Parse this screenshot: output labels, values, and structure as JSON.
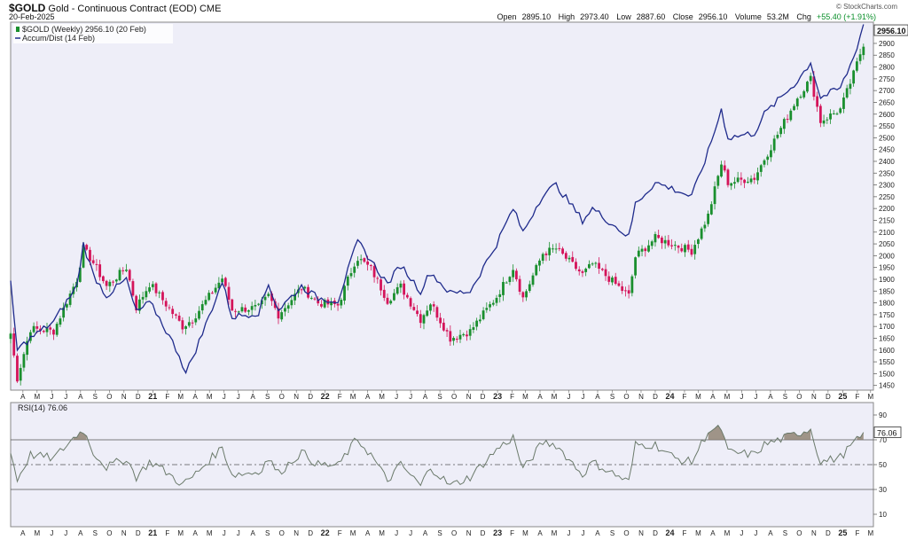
{
  "header": {
    "symbol": "$GOLD",
    "description": "Gold - Continuous Contract (EOD)",
    "exchange": "CME",
    "date": "20-Feb-2025",
    "source": "© StockCharts.com",
    "ohlc": {
      "open_label": "Open",
      "open": "2895.10",
      "high_label": "High",
      "high": "2973.40",
      "low_label": "Low",
      "low": "2887.60",
      "close_label": "Close",
      "close": "2956.10",
      "volume_label": "Volume",
      "volume": "53.2M",
      "chg_label": "Chg",
      "chg": "+55.40 (+1.91%)"
    }
  },
  "colors": {
    "up": "#1a8f2e",
    "down": "#d4145a",
    "accum": "#1f2b8c",
    "rsi": "#6b7a6b",
    "bg": "#eeeef8"
  },
  "chart_data": [
    {
      "type": "candlestick",
      "title": "$GOLD (Weekly)",
      "legend": [
        "$GOLD (Weekly) 2956.10 (20 Feb)",
        "Accum/Dist (14 Feb)"
      ],
      "y_ticks": [
        1450,
        1500,
        1550,
        1600,
        1650,
        1700,
        1750,
        1800,
        1850,
        1900,
        1950,
        2000,
        2050,
        2100,
        2150,
        2200,
        2250,
        2300,
        2350,
        2400,
        2450,
        2500,
        2550,
        2600,
        2650,
        2700,
        2750,
        2800,
        2850,
        2900
      ],
      "ylim": [
        1430,
        2990
      ],
      "last_value_label": "2956.10",
      "x_month_labels": [
        "M",
        "A",
        "M",
        "J",
        "J",
        "A",
        "S",
        "O",
        "N",
        "D",
        "21",
        "F",
        "M",
        "A",
        "M",
        "J",
        "J",
        "A",
        "S",
        "O",
        "N",
        "D",
        "22",
        "F",
        "M",
        "A",
        "M",
        "J",
        "J",
        "A",
        "S",
        "O",
        "N",
        "D",
        "23",
        "F",
        "M",
        "A",
        "M",
        "J",
        "J",
        "A",
        "S",
        "O",
        "N",
        "D",
        "24",
        "F",
        "M",
        "A",
        "M",
        "J",
        "J",
        "A",
        "S",
        "O",
        "N",
        "D",
        "25",
        "F",
        "M"
      ],
      "close_anchors": [
        [
          "2020-03-06",
          1670
        ],
        [
          "2020-03-20",
          1480
        ],
        [
          "2020-04-17",
          1690
        ],
        [
          "2020-06-05",
          1680
        ],
        [
          "2020-07-24",
          1900
        ],
        [
          "2020-08-07",
          2030
        ],
        [
          "2020-08-28",
          1970
        ],
        [
          "2020-09-25",
          1870
        ],
        [
          "2020-11-06",
          1950
        ],
        [
          "2020-11-27",
          1780
        ],
        [
          "2020-12-25",
          1880
        ],
        [
          "2021-01-08",
          1850
        ],
        [
          "2021-03-05",
          1700
        ],
        [
          "2021-03-26",
          1730
        ],
        [
          "2021-05-28",
          1905
        ],
        [
          "2021-06-18",
          1770
        ],
        [
          "2021-08-13",
          1780
        ],
        [
          "2021-09-03",
          1830
        ],
        [
          "2021-09-24",
          1750
        ],
        [
          "2021-11-12",
          1865
        ],
        [
          "2021-12-17",
          1800
        ],
        [
          "2022-01-28",
          1790
        ],
        [
          "2022-03-04",
          1970
        ],
        [
          "2022-03-11",
          1990
        ],
        [
          "2022-04-08",
          1945
        ],
        [
          "2022-05-13",
          1810
        ],
        [
          "2022-06-10",
          1870
        ],
        [
          "2022-07-22",
          1730
        ],
        [
          "2022-08-12",
          1800
        ],
        [
          "2022-09-23",
          1650
        ],
        [
          "2022-11-04",
          1680
        ],
        [
          "2022-12-30",
          1826
        ],
        [
          "2023-02-03",
          1950
        ],
        [
          "2023-02-24",
          1820
        ],
        [
          "2023-04-07",
          2010
        ],
        [
          "2023-05-05",
          2030
        ],
        [
          "2023-06-30",
          1920
        ],
        [
          "2023-07-21",
          1965
        ],
        [
          "2023-10-06",
          1830
        ],
        [
          "2023-10-20",
          1995
        ],
        [
          "2023-12-01",
          2075
        ],
        [
          "2024-01-12",
          2045
        ],
        [
          "2024-02-16",
          2020
        ],
        [
          "2024-03-22",
          2170
        ],
        [
          "2024-04-19",
          2390
        ],
        [
          "2024-05-03",
          2310
        ],
        [
          "2024-06-28",
          2330
        ],
        [
          "2024-07-19",
          2410
        ],
        [
          "2024-09-27",
          2670
        ],
        [
          "2024-10-25",
          2750
        ],
        [
          "2024-11-15",
          2570
        ],
        [
          "2024-12-27",
          2620
        ],
        [
          "2025-01-24",
          2770
        ],
        [
          "2025-02-14",
          2900
        ],
        [
          "2025-02-20",
          2956
        ]
      ]
    },
    {
      "type": "line",
      "title": "Accum/Dist (14 Feb)",
      "anchors_price_units": [
        [
          "2020-03-06",
          1880
        ],
        [
          "2020-03-20",
          1600
        ],
        [
          "2020-04-17",
          1650
        ],
        [
          "2020-06-05",
          1720
        ],
        [
          "2020-07-24",
          1870
        ],
        [
          "2020-08-07",
          2050
        ],
        [
          "2020-08-28",
          1920
        ],
        [
          "2020-09-25",
          1830
        ],
        [
          "2020-11-06",
          1900
        ],
        [
          "2020-11-27",
          1760
        ],
        [
          "2020-12-25",
          1800
        ],
        [
          "2021-01-08",
          1760
        ],
        [
          "2021-02-26",
          1580
        ],
        [
          "2021-03-12",
          1500
        ],
        [
          "2021-04-16",
          1670
        ],
        [
          "2021-05-28",
          1890
        ],
        [
          "2021-06-18",
          1740
        ],
        [
          "2021-08-13",
          1760
        ],
        [
          "2021-09-03",
          1880
        ],
        [
          "2021-09-24",
          1770
        ],
        [
          "2021-11-12",
          1870
        ],
        [
          "2021-12-17",
          1820
        ],
        [
          "2022-01-28",
          1810
        ],
        [
          "2022-03-04",
          2020
        ],
        [
          "2022-03-11",
          2060
        ],
        [
          "2022-04-08",
          1980
        ],
        [
          "2022-05-13",
          1880
        ],
        [
          "2022-06-10",
          1960
        ],
        [
          "2022-07-22",
          1850
        ],
        [
          "2022-08-12",
          1930
        ],
        [
          "2022-09-23",
          1840
        ],
        [
          "2022-11-04",
          1850
        ],
        [
          "2022-12-30",
          2050
        ],
        [
          "2023-02-03",
          2200
        ],
        [
          "2023-02-24",
          2100
        ],
        [
          "2023-04-07",
          2260
        ],
        [
          "2023-05-05",
          2300
        ],
        [
          "2023-06-30",
          2150
        ],
        [
          "2023-07-21",
          2200
        ],
        [
          "2023-10-06",
          2080
        ],
        [
          "2023-10-20",
          2220
        ],
        [
          "2023-12-01",
          2310
        ],
        [
          "2024-01-12",
          2280
        ],
        [
          "2024-02-16",
          2250
        ],
        [
          "2024-03-22",
          2440
        ],
        [
          "2024-04-19",
          2620
        ],
        [
          "2024-05-03",
          2500
        ],
        [
          "2024-06-28",
          2520
        ],
        [
          "2024-07-19",
          2600
        ],
        [
          "2024-09-27",
          2740
        ],
        [
          "2024-10-25",
          2820
        ],
        [
          "2024-11-15",
          2670
        ],
        [
          "2024-12-27",
          2710
        ],
        [
          "2025-01-24",
          2840
        ],
        [
          "2025-02-14",
          2980
        ]
      ]
    },
    {
      "type": "line",
      "title": "RSI(14) 76.06",
      "legend": "RSI(14) 76.06",
      "y_ticks": [
        10,
        30,
        50,
        70,
        90
      ],
      "ylim": [
        0,
        100
      ],
      "overbought": 70,
      "oversold": 30,
      "midline": 50,
      "last_value_label": "76.06",
      "anchors": [
        [
          "2020-03-06",
          60
        ],
        [
          "2020-03-20",
          38
        ],
        [
          "2020-04-17",
          58
        ],
        [
          "2020-06-05",
          55
        ],
        [
          "2020-07-24",
          74
        ],
        [
          "2020-08-07",
          78
        ],
        [
          "2020-08-28",
          60
        ],
        [
          "2020-09-25",
          48
        ],
        [
          "2020-11-06",
          55
        ],
        [
          "2020-11-27",
          40
        ],
        [
          "2020-12-25",
          52
        ],
        [
          "2021-01-08",
          50
        ],
        [
          "2021-03-05",
          34
        ],
        [
          "2021-03-26",
          40
        ],
        [
          "2021-05-28",
          64
        ],
        [
          "2021-06-18",
          42
        ],
        [
          "2021-08-13",
          44
        ],
        [
          "2021-09-03",
          55
        ],
        [
          "2021-09-24",
          43
        ],
        [
          "2021-11-12",
          60
        ],
        [
          "2021-12-17",
          50
        ],
        [
          "2022-01-28",
          49
        ],
        [
          "2022-03-04",
          68
        ],
        [
          "2022-03-11",
          70
        ],
        [
          "2022-04-08",
          58
        ],
        [
          "2022-05-13",
          37
        ],
        [
          "2022-06-10",
          50
        ],
        [
          "2022-07-22",
          33
        ],
        [
          "2022-08-12",
          48
        ],
        [
          "2022-09-23",
          33
        ],
        [
          "2022-11-04",
          40
        ],
        [
          "2022-12-30",
          62
        ],
        [
          "2023-02-03",
          72
        ],
        [
          "2023-02-24",
          46
        ],
        [
          "2023-04-07",
          68
        ],
        [
          "2023-05-05",
          66
        ],
        [
          "2023-06-30",
          42
        ],
        [
          "2023-07-21",
          52
        ],
        [
          "2023-10-06",
          36
        ],
        [
          "2023-10-20",
          66
        ],
        [
          "2023-12-01",
          66
        ],
        [
          "2024-01-12",
          55
        ],
        [
          "2024-02-16",
          52
        ],
        [
          "2024-03-22",
          77
        ],
        [
          "2024-04-19",
          79
        ],
        [
          "2024-05-03",
          60
        ],
        [
          "2024-06-28",
          58
        ],
        [
          "2024-07-19",
          66
        ],
        [
          "2024-09-27",
          75
        ],
        [
          "2024-10-25",
          79
        ],
        [
          "2024-11-15",
          52
        ],
        [
          "2024-12-27",
          56
        ],
        [
          "2025-01-24",
          67
        ],
        [
          "2025-02-14",
          74
        ],
        [
          "2025-02-20",
          76.06
        ]
      ]
    }
  ]
}
